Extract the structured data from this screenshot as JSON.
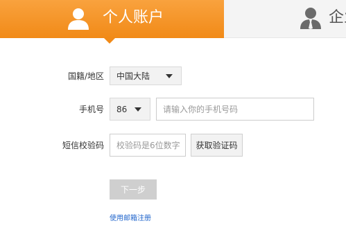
{
  "tabs": {
    "personal": {
      "label": "个人账户",
      "icon": "user-icon",
      "active": true
    },
    "company": {
      "label": "企业",
      "icon": "business-user-icon",
      "active": false
    }
  },
  "colors": {
    "accent": "#f18a17",
    "link": "#2266cc"
  },
  "form": {
    "nationality": {
      "label": "国籍/地区",
      "value": "中国大陆"
    },
    "phone": {
      "label": "手机号",
      "country_code": "86",
      "placeholder": "请输入你的手机号码"
    },
    "sms": {
      "label": "短信校验码",
      "placeholder": "校验码是6位数字",
      "get_code_label": "获取验证码"
    },
    "next_label": "下一步",
    "email_register_label": "使用邮箱注册"
  }
}
